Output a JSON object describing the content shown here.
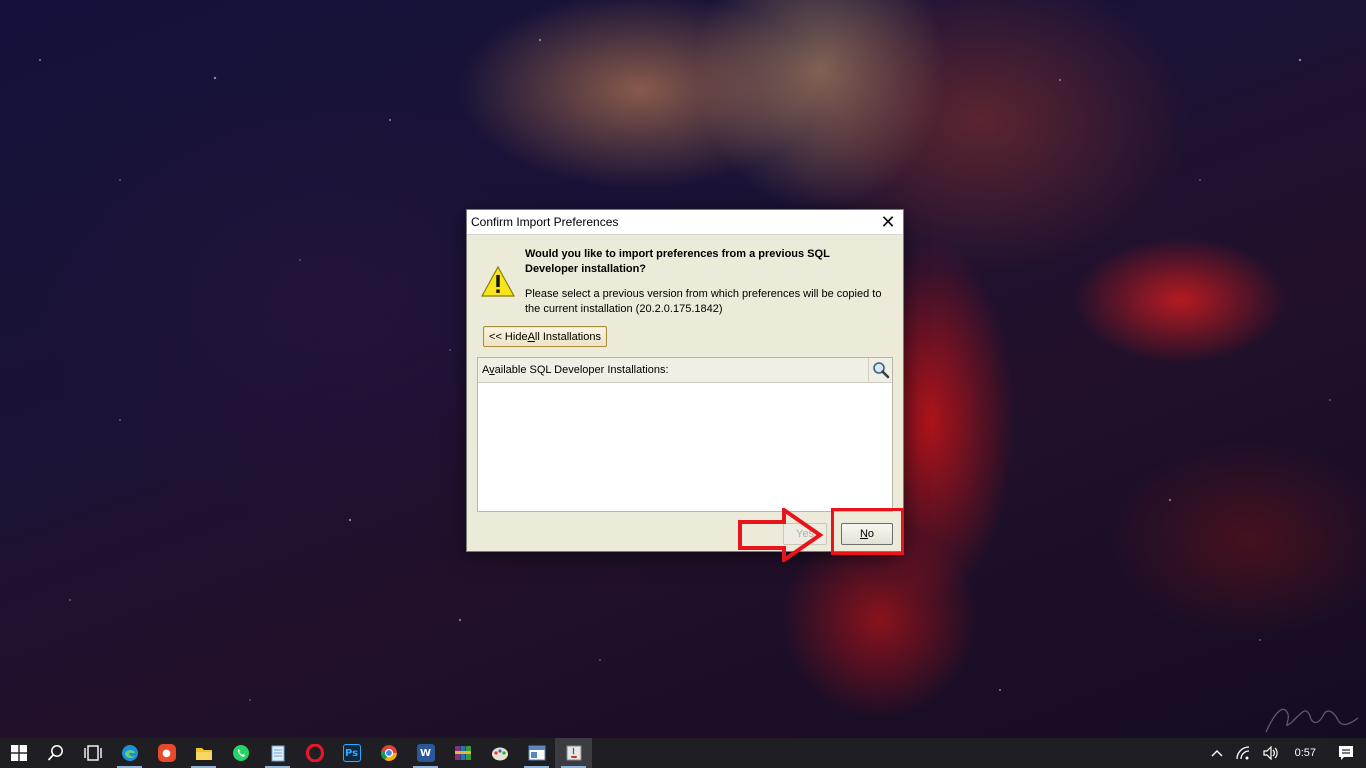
{
  "dialog": {
    "title": "Confirm Import Preferences",
    "close_glyph": "✕",
    "heading": "Would you like to import preferences from a previous SQL Developer installation?",
    "description": "Please select a previous version from which preferences will be copied to the current installation (20.2.0.175.1842)",
    "hide_button_prefix": "<< Hide ",
    "hide_button_mnemonic": "A",
    "hide_button_suffix": "ll Installations",
    "list_label_prefix": "A",
    "list_label_mnemonic": "v",
    "list_label_suffix": "ailable SQL Developer Installations:",
    "yes_label": "Yes",
    "no_mnemonic": "N",
    "no_suffix": "o"
  },
  "taskbar": {
    "apps": [
      {
        "name": "start-button",
        "icon": "windows-icon"
      },
      {
        "name": "search-button",
        "icon": "search-icon"
      },
      {
        "name": "task-view-button",
        "icon": "task-view-icon"
      },
      {
        "name": "edge-button",
        "icon": "edge-icon",
        "color": "#1e8fd8"
      },
      {
        "name": "app-button-red",
        "icon": "app-icon",
        "color": "#e8492b"
      },
      {
        "name": "file-explorer-button",
        "icon": "folder-icon",
        "color": "#f2c230"
      },
      {
        "name": "whatsapp-button",
        "icon": "whatsapp-icon",
        "color": "#25d366"
      },
      {
        "name": "notepad-button",
        "icon": "notepad-icon",
        "color": "#9ec7e8"
      },
      {
        "name": "opera-button",
        "icon": "opera-icon",
        "color": "#e3182d"
      },
      {
        "name": "photoshop-button",
        "icon": "photoshop-icon",
        "color": "#0b2a44",
        "label": "Ps"
      },
      {
        "name": "chrome-button",
        "icon": "chrome-icon",
        "color": "#e6b320"
      },
      {
        "name": "word-button",
        "icon": "word-icon",
        "color": "#2b5797",
        "label": "W"
      },
      {
        "name": "winrar-button",
        "icon": "winrar-icon",
        "color": "#8b2c7c"
      },
      {
        "name": "paint-button",
        "icon": "paint-icon",
        "color": "#6aa84f"
      },
      {
        "name": "app-window-button",
        "icon": "window-icon",
        "color": "#5a86c0"
      },
      {
        "name": "sql-developer-button",
        "icon": "java-icon",
        "color": "#c9c9c9"
      }
    ],
    "tray": {
      "chevron": "^",
      "clock": "0:57"
    }
  },
  "colors": {
    "dialog_bg": "#ecead9",
    "highlight": "#e8141c",
    "taskbar_bg": "#1f1f23"
  }
}
